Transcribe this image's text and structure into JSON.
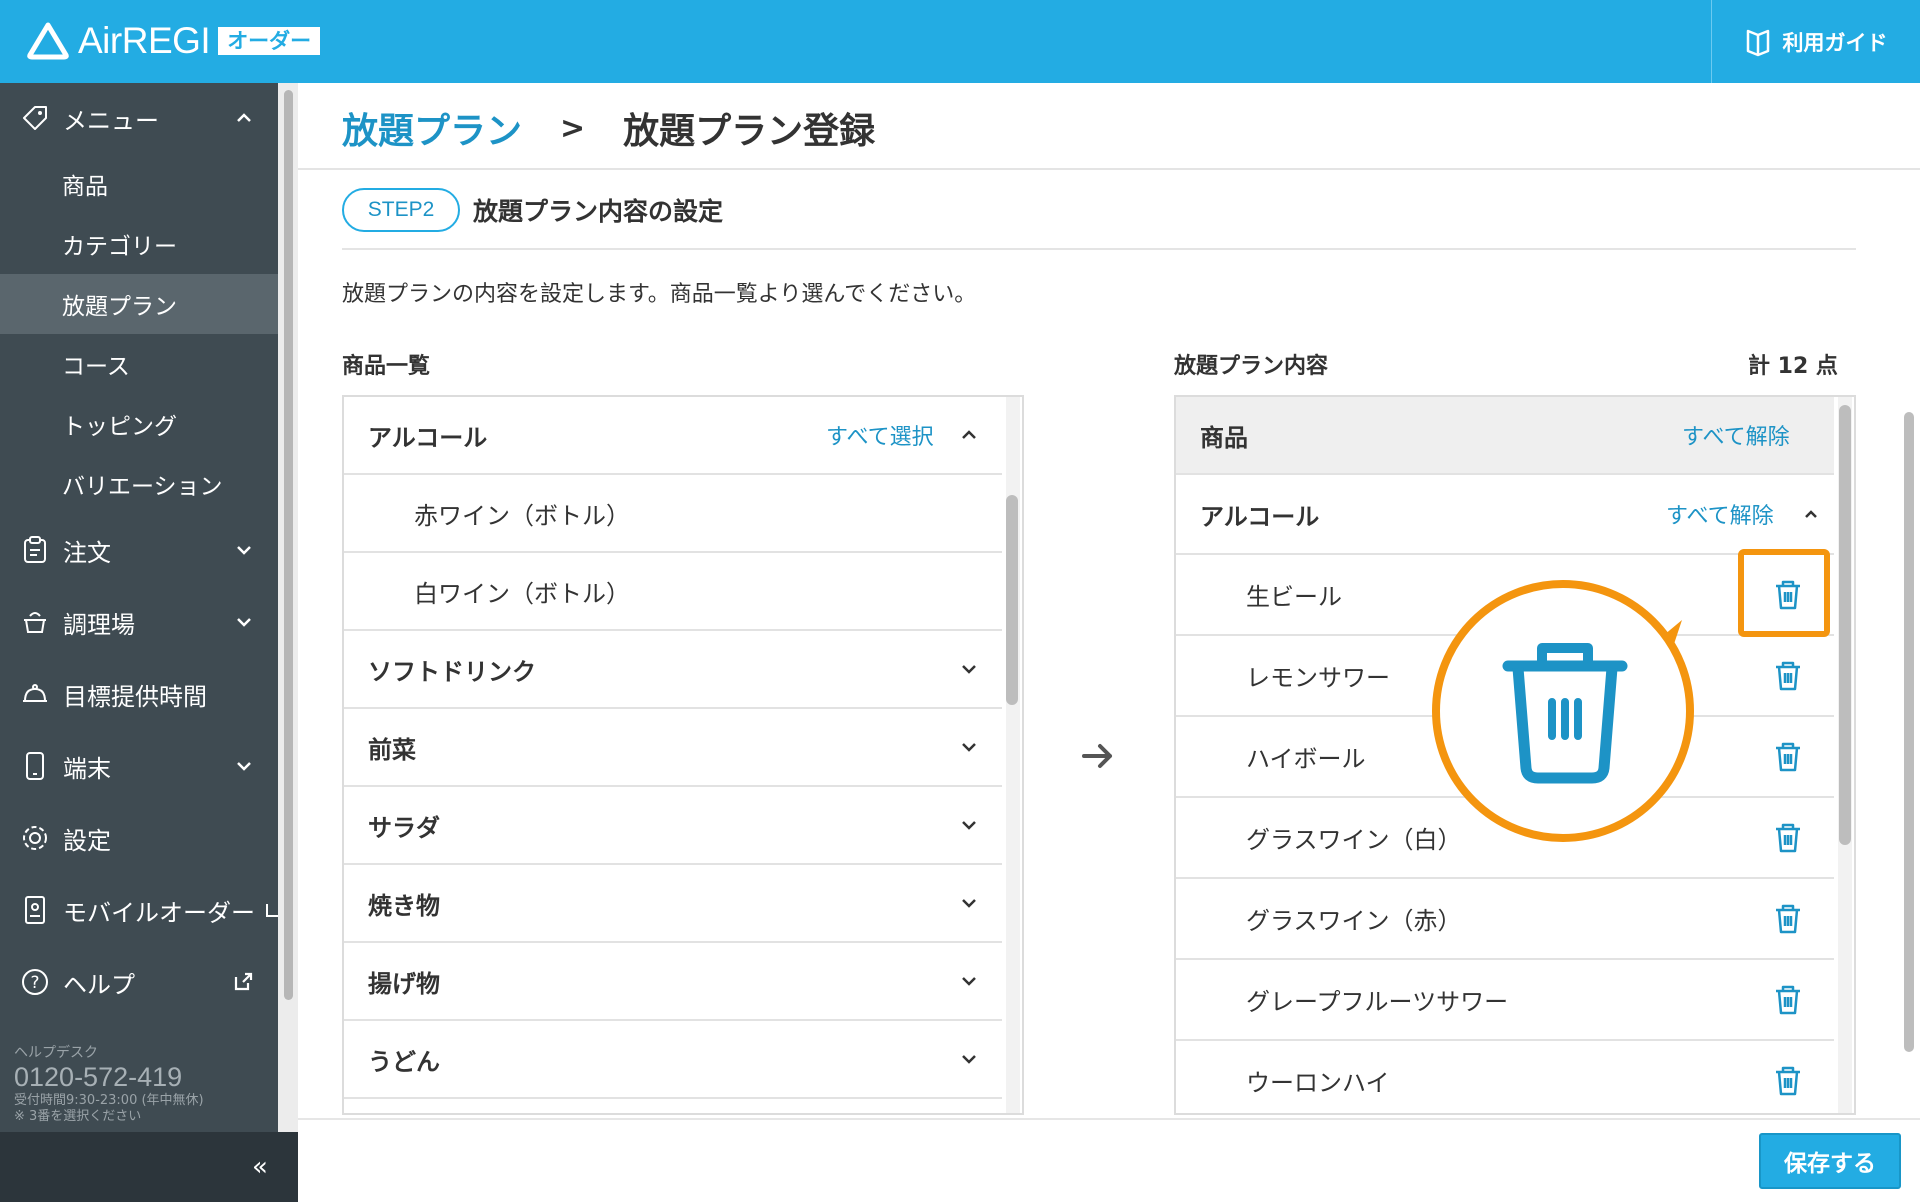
{
  "header": {
    "logo_text": "AirREGI",
    "logo_badge": "オーダー",
    "guide_label": "利用ガイド",
    "bg_color": "#23ace3"
  },
  "sidebar": {
    "menu_label": "メニュー",
    "sub_items": [
      "商品",
      "カテゴリー",
      "放題プラン",
      "コース",
      "トッピング",
      "バリエーション"
    ],
    "active_sub_item": "放題プラン",
    "items": [
      {
        "label": "注文",
        "icon": "clipboard-icon"
      },
      {
        "label": "調理場",
        "icon": "cooking-pot-icon"
      },
      {
        "label": "目標提供時間",
        "icon": "cloche-icon"
      },
      {
        "label": "端末",
        "icon": "smartphone-icon"
      },
      {
        "label": "設定",
        "icon": "gear-icon"
      },
      {
        "label": "モバイルオーダー",
        "icon": "mobile-order-icon"
      },
      {
        "label": "ヘルプ",
        "icon": "help-circle-icon"
      }
    ],
    "helpdesk": {
      "title": "ヘルプデスク",
      "phone": "0120-572-419",
      "hours": "受付時間9:30-23:00 (年中無休)",
      "note": "※ 3番を選択ください"
    },
    "collapse_label": "«"
  },
  "breadcrumb": {
    "parent": "放題プラン",
    "separator": ">",
    "current": "放題プラン登録"
  },
  "step": {
    "badge": "STEP2",
    "title": "放題プラン内容の設定",
    "description": "放題プランの内容を設定します。商品一覧より選んでください。"
  },
  "left_panel": {
    "title": "商品一覧",
    "groups": [
      {
        "label": "アルコール",
        "action": "すべて選択",
        "expanded": true,
        "items": [
          "赤ワイン（ボトル）",
          "白ワイン（ボトル）"
        ]
      },
      {
        "label": "ソフトドリンク",
        "expanded": false
      },
      {
        "label": "前菜",
        "expanded": false
      },
      {
        "label": "サラダ",
        "expanded": false
      },
      {
        "label": "焼き物",
        "expanded": false
      },
      {
        "label": "揚げ物",
        "expanded": false
      },
      {
        "label": "うどん",
        "expanded": false
      }
    ]
  },
  "right_panel": {
    "title": "放題プラン内容",
    "total": "計 12 点",
    "header_label": "商品",
    "header_action": "すべて解除",
    "group_label": "アルコール",
    "group_action": "すべて解除",
    "items": [
      "生ビール",
      "レモンサワー",
      "ハイボール",
      "グラスワイン（白）",
      "グラスワイン（赤）",
      "グレープフルーツサワー",
      "ウーロンハイ"
    ]
  },
  "footer": {
    "save_label": "保存する"
  },
  "colors": {
    "accent": "#23ace3",
    "link": "#1d93c6",
    "highlight": "#f4950f",
    "sidebar": "#3f4b52"
  }
}
